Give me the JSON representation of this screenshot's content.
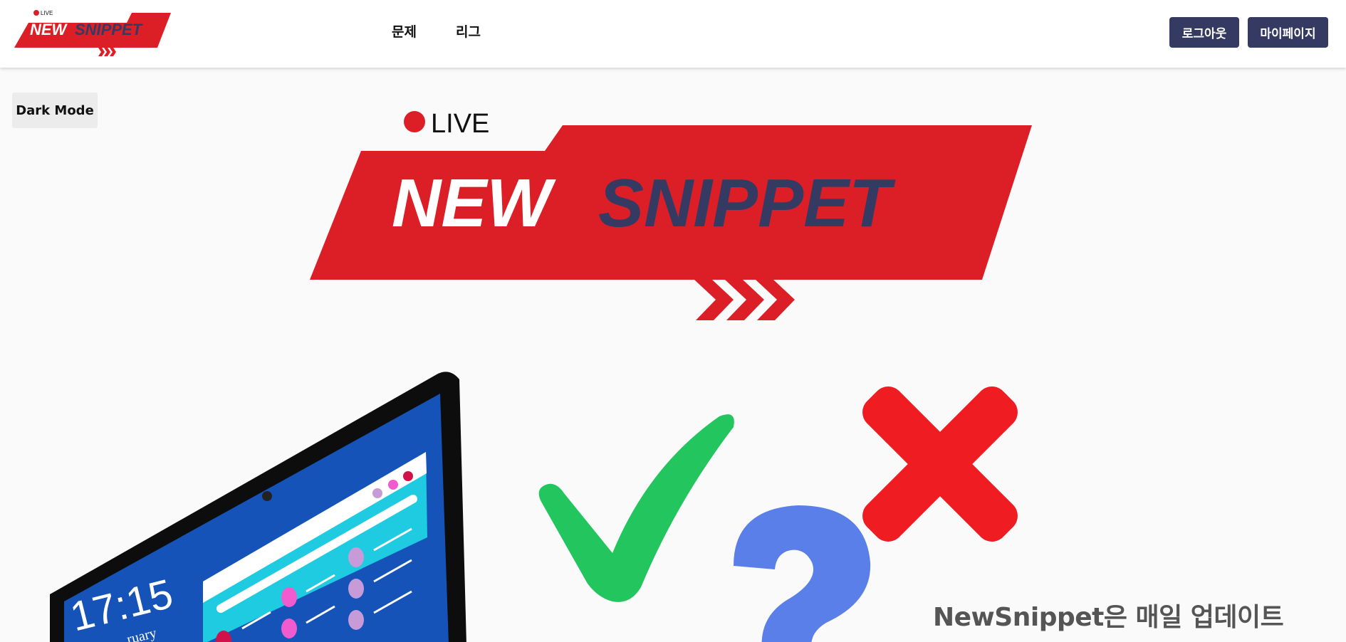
{
  "header": {
    "logo": {
      "live": "LIVE",
      "brand_new": "NEW",
      "brand_snippet": "SNIPPET"
    },
    "nav": [
      {
        "label": "문제"
      },
      {
        "label": "리그"
      }
    ],
    "buttons": {
      "logout": "로그아웃",
      "mypage": "마이페이지"
    }
  },
  "dark_mode_label": "Dark Mode",
  "hero": {
    "logo": {
      "live": "LIVE",
      "brand_new": "NEW",
      "brand_snippet": "SNIPPET"
    },
    "device_clock": "17:15",
    "device_date_partial": "ruary"
  },
  "tagline": "NewSnippet은 매일 업데이트",
  "colors": {
    "brand_red": "#dc1f26",
    "brand_navy": "#353a63",
    "check_green": "#22c55e",
    "x_red": "#ef1c22",
    "question_blue": "#5b7fe8",
    "screen_blue": "#1553b8"
  }
}
